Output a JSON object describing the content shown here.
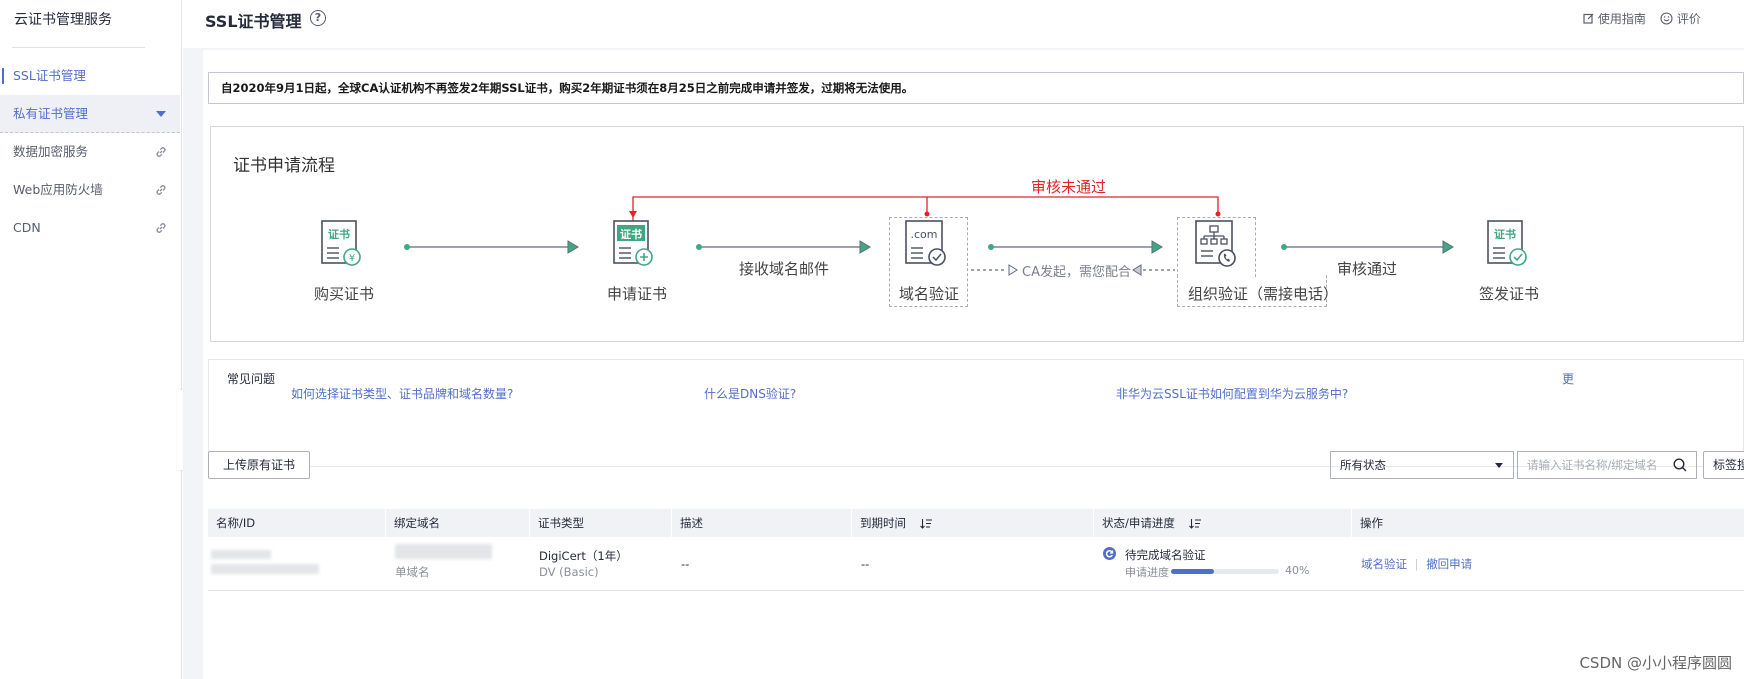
{
  "sidebar": {
    "title": "云证书管理服务",
    "items": [
      {
        "label": "SSL证书管理"
      },
      {
        "label": "私有证书管理"
      },
      {
        "label": "数据加密服务"
      },
      {
        "label": "Web应用防火墙"
      },
      {
        "label": "CDN"
      }
    ]
  },
  "header": {
    "title": "SSL证书管理",
    "help_icon": "?",
    "guide_label": "使用指南",
    "rate_label": "评价"
  },
  "notice": "自2020年9月1日起，全球CA认证机构不再签发2年期SSL证书，购买2年期证书须在8月25日之前完成申请并签发，过期将无法使用。",
  "flow": {
    "title": "证书申请流程",
    "steps": [
      {
        "label": "购买证书",
        "icon_text": "证书",
        "icon": "yen-icon"
      },
      {
        "label": "申请证书",
        "icon_text": "证书",
        "icon": "plus-icon"
      },
      {
        "label": "域名验证",
        "icon_text": ".com",
        "icon": "check-icon"
      },
      {
        "label": "组织验证（需接电话）",
        "icon": "org-phone-icon"
      },
      {
        "label": "签发证书",
        "icon_text": "证书",
        "icon": "check-icon"
      }
    ],
    "edge_labels": {
      "email": "接收域名邮件",
      "ca": "CA发起，需您配合",
      "approved": "审核通过",
      "rejected": "审核未通过"
    },
    "colors": {
      "line": "#5f6b7a",
      "dot": "#3fa883",
      "reject": "#e0242a",
      "accent": "#3fa883"
    }
  },
  "faq": {
    "heading": "常见问题",
    "links": [
      "如何选择证书类型、证书品牌和域名数量?",
      "什么是DNS验证?",
      "非华为云SSL证书如何配置到华为云服务中?"
    ],
    "more": "更"
  },
  "toolbar": {
    "upload_label": "上传原有证书",
    "status_select": "所有状态",
    "search_placeholder": "请输入证书名称/绑定域名",
    "tag_search": "标签搜索"
  },
  "table": {
    "columns": [
      "名称/ID",
      "绑定域名",
      "证书类型",
      "描述",
      "到期时间",
      "状态/申请进度",
      "操作"
    ],
    "rows": [
      {
        "domain_sub": "单域名",
        "type": "DigiCert（1年）",
        "type_sub": "DV (Basic)",
        "desc": "--",
        "expire": "--",
        "status": "待完成域名验证",
        "progress_label": "申请进度",
        "progress": 40,
        "progress_text": "40%",
        "actions": [
          "域名验证",
          "撤回申请"
        ]
      }
    ]
  },
  "watermark": "CSDN @小小程序圆圆"
}
